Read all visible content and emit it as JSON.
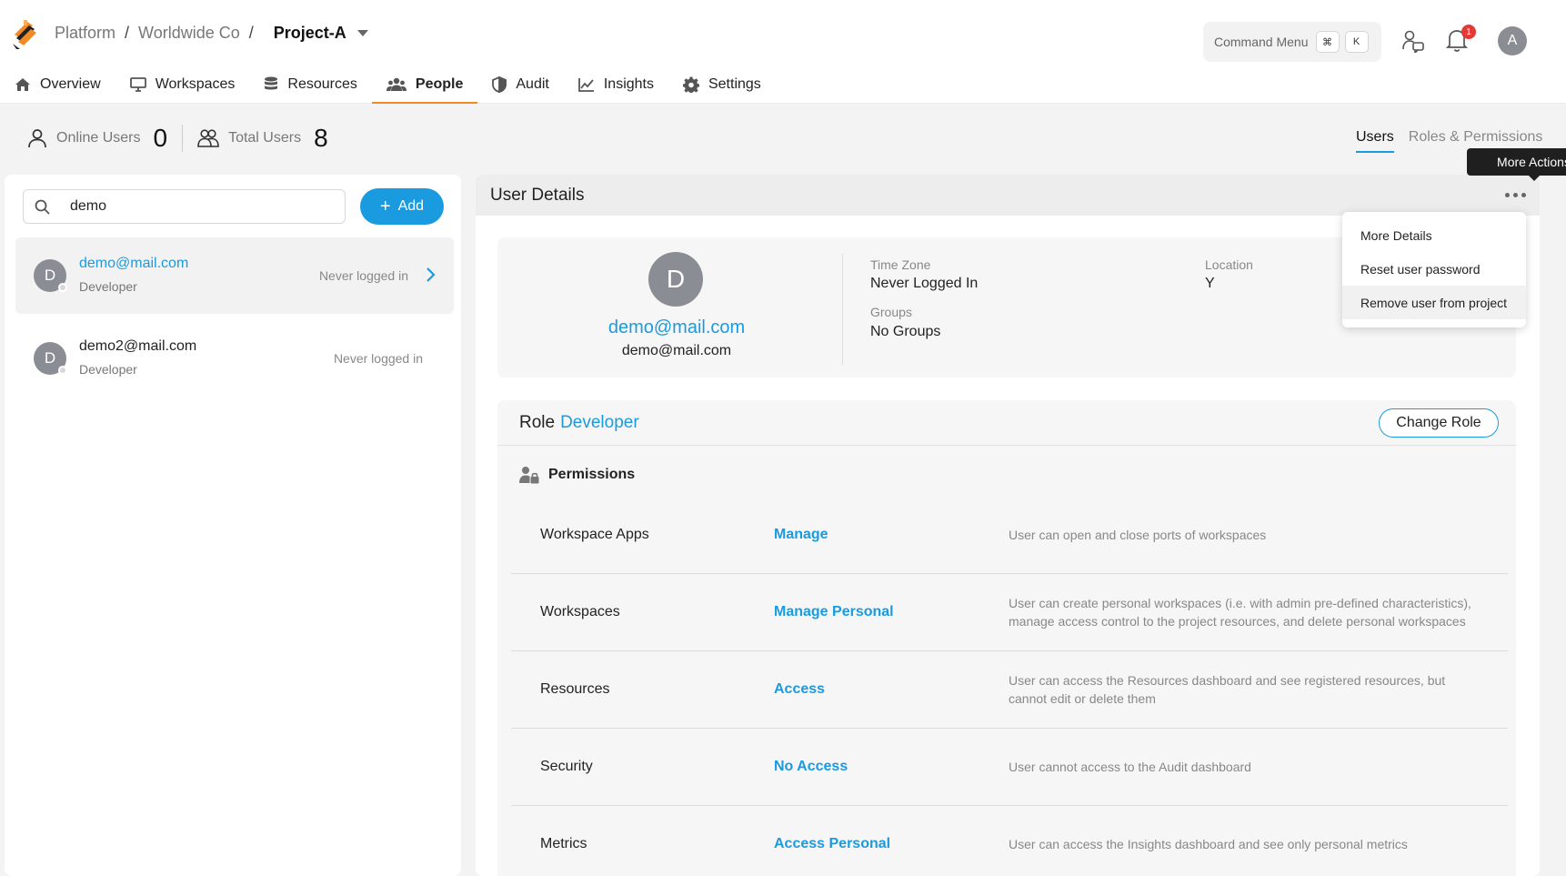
{
  "breadcrumb": {
    "platform": "Platform",
    "org": "Worldwide Co",
    "project": "Project-A",
    "separator": "/"
  },
  "command_menu": {
    "label": "Command Menu",
    "keys": [
      "⌘",
      "K"
    ]
  },
  "notifications": {
    "count": "1"
  },
  "user_avatar": {
    "initial": "A"
  },
  "nav": {
    "items": [
      {
        "label": "Overview",
        "icon": "home-icon"
      },
      {
        "label": "Workspaces",
        "icon": "monitor-icon"
      },
      {
        "label": "Resources",
        "icon": "database-icon"
      },
      {
        "label": "People",
        "icon": "people-icon",
        "active": true
      },
      {
        "label": "Audit",
        "icon": "shield-icon"
      },
      {
        "label": "Insights",
        "icon": "chart-icon"
      },
      {
        "label": "Settings",
        "icon": "gear-icon"
      }
    ]
  },
  "stats": {
    "online_label": "Online Users",
    "online_count": "0",
    "total_label": "Total Users",
    "total_count": "8"
  },
  "right_tabs": {
    "users": "Users",
    "roles": "Roles & Permissions"
  },
  "tooltip": "More Actions",
  "search": {
    "value": "demo",
    "placeholder": ""
  },
  "add_button": "Add",
  "users": [
    {
      "initial": "D",
      "email": "demo@mail.com",
      "role": "Developer",
      "last_login": "Never logged in",
      "selected": true
    },
    {
      "initial": "D",
      "email": "demo2@mail.com",
      "role": "Developer",
      "last_login": "Never logged in",
      "selected": false
    }
  ],
  "details": {
    "title": "User Details",
    "initial": "D",
    "email_link": "demo@mail.com",
    "email": "demo@mail.com",
    "timezone_label": "Time Zone",
    "timezone_value": "Never Logged In",
    "location_label": "Location",
    "location_value": "Y",
    "groups_label": "Groups",
    "groups_value": "No Groups"
  },
  "role": {
    "label": "Role",
    "value": "Developer",
    "change_button": "Change Role"
  },
  "permissions": {
    "title": "Permissions",
    "rows": [
      {
        "name": "Workspace Apps",
        "level": "Manage",
        "desc": "User can open and close ports of workspaces"
      },
      {
        "name": "Workspaces",
        "level": "Manage Personal",
        "desc": "User can create personal workspaces (i.e. with admin pre-defined characteristics), manage access control to the project resources, and delete personal workspaces"
      },
      {
        "name": "Resources",
        "level": "Access",
        "desc": "User can access the Resources dashboard and see registered resources, but cannot edit or delete them"
      },
      {
        "name": "Security",
        "level": "No Access",
        "desc": "User cannot access to the Audit dashboard"
      },
      {
        "name": "Metrics",
        "level": "Access Personal",
        "desc": "User can access the Insights dashboard and see only personal metrics"
      }
    ]
  },
  "menu": {
    "items": [
      "More Details",
      "Reset user password",
      "Remove user from project"
    ]
  },
  "colors": {
    "accent": "#1a9be0",
    "active_tab": "#f08a24",
    "badge": "#e53935"
  }
}
